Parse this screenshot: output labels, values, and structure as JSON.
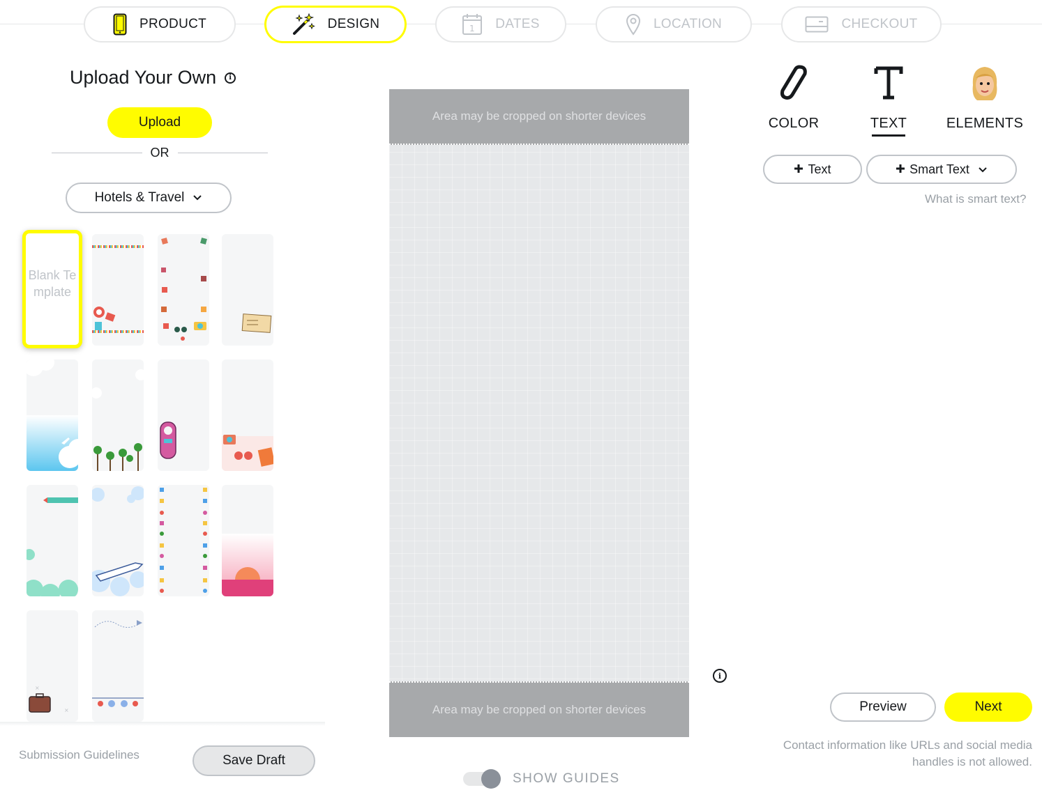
{
  "steps": [
    {
      "label": "PRODUCT",
      "icon": "phone-icon",
      "state": "done"
    },
    {
      "label": "DESIGN",
      "icon": "magic-wand-icon",
      "state": "active"
    },
    {
      "label": "DATES",
      "icon": "calendar-icon",
      "state": "todo"
    },
    {
      "label": "LOCATION",
      "icon": "location-pin-icon",
      "state": "todo"
    },
    {
      "label": "CHECKOUT",
      "icon": "credit-card-icon",
      "state": "todo"
    }
  ],
  "left": {
    "title": "Upload Your Own",
    "upload_label": "Upload",
    "or_label": "OR",
    "category": "Hotels & Travel",
    "blank_template_label": "Blank Template",
    "templates": [
      "blank",
      "airmail-border",
      "photo-frames",
      "postcard",
      "sky-clouds-plane",
      "palm-trees",
      "door-hanger",
      "sunglasses-camera",
      "airplane-banner",
      "clouds-jet",
      "travel-icons-border",
      "pink-sunset",
      "suitcase",
      "paper-plane"
    ],
    "submission_guidelines": "Submission Guidelines",
    "save_draft": "Save Draft"
  },
  "canvas": {
    "crop_notice_top": "Area may be cropped on shorter devices",
    "crop_notice_bottom": "Area may be cropped on shorter devices",
    "show_guides_label": "SHOW GUIDES"
  },
  "tools": {
    "tabs": [
      {
        "label": "COLOR",
        "icon": "paint-pen-icon"
      },
      {
        "label": "TEXT",
        "icon": "text-t-icon",
        "active": true
      },
      {
        "label": "ELEMENTS",
        "icon": "bitmoji-avatar-icon"
      }
    ],
    "add_text": "Text",
    "smart_text": "Smart Text",
    "smart_text_help": "What is smart text?",
    "preview": "Preview",
    "next": "Next",
    "disclaimer": "Contact information like URLs and social media handles is not allowed."
  },
  "colors": {
    "accent": "#fffc00",
    "border": "#c0c4c9",
    "muted": "#9aa0a6",
    "text": "#16191c"
  }
}
